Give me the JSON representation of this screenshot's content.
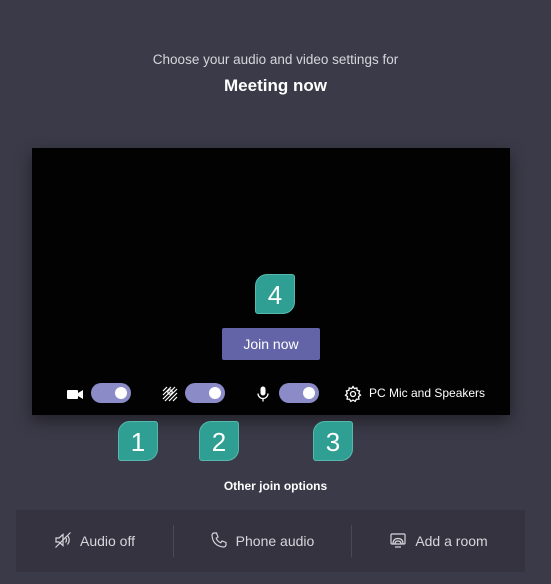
{
  "header": {
    "subtitle": "Choose your audio and video settings for",
    "title": "Meeting now"
  },
  "preview": {
    "join_label": "Join now",
    "device_label": "PC Mic and Speakers",
    "camera_on": true,
    "background_blur_on": true,
    "microphone_on": true
  },
  "callouts": {
    "camera": "1",
    "background": "2",
    "microphone": "3",
    "join": "4"
  },
  "other_options": {
    "label": "Other join options",
    "items": [
      {
        "label": "Audio off",
        "icon": "speaker-off-icon"
      },
      {
        "label": "Phone audio",
        "icon": "phone-icon"
      },
      {
        "label": "Add a room",
        "icon": "cast-room-icon"
      }
    ]
  },
  "colors": {
    "background": "#3b3a48",
    "accent": "#6264a7",
    "toggle_on": "#8b8cc7",
    "callout": "#2f9e93"
  }
}
